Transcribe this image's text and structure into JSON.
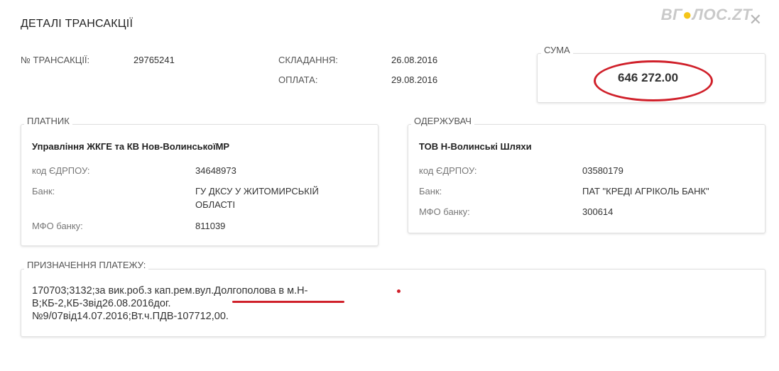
{
  "header": {
    "title": "ДЕТАЛІ ТРАНСАКЦІЇ",
    "logo_text_a": "ВГ",
    "logo_text_b": "ЛОС.ZT",
    "close_glyph": "✕"
  },
  "transaction": {
    "number_label": "№ ТРАНСАКЦІЇ:",
    "number_value": "29765241",
    "drafted_label": "СКЛАДАННЯ:",
    "drafted_value": "26.08.2016",
    "paid_label": "ОПЛАТА:",
    "paid_value": "29.08.2016"
  },
  "sum": {
    "legend": "СУМА",
    "amount": "646 272.00"
  },
  "payer": {
    "legend": "ПЛАТНИК",
    "name": "Управління ЖКГЕ та КВ Нов-ВолинськоїМР",
    "edrpou_label": "код ЄДРПОУ:",
    "edrpou_value": "34648973",
    "bank_label": "Банк:",
    "bank_value_line1": "ГУ ДКСУ У ЖИТОМИРСЬКІЙ",
    "bank_value_line2": "ОБЛАСТІ",
    "mfo_label": "МФО банку:",
    "mfo_value": "811039"
  },
  "recipient": {
    "legend": "ОДЕРЖУВАЧ",
    "name": "ТОВ Н-Волинські Шляхи",
    "edrpou_label": "код ЄДРПОУ:",
    "edrpou_value": "03580179",
    "bank_label": "Банк:",
    "bank_value": "ПАТ \"КРЕДІ АГРІКОЛЬ БАНК\"",
    "mfo_label": "МФО банку:",
    "mfo_value": "300614"
  },
  "purpose": {
    "legend": "ПРИЗНАЧЕННЯ ПЛАТЕЖУ:",
    "line1": "170703;3132;за вик.роб.з кап.рем.вул.Долгополова в м.Н-",
    "line2": "В;КБ-2,КБ-3від26.08.2016дог.",
    "line3": "№9/07від14.07.2016;Вт.ч.ПДВ-107712,00."
  },
  "colors": {
    "annotation_red": "#d0202a",
    "border": "#e0e0e0"
  }
}
